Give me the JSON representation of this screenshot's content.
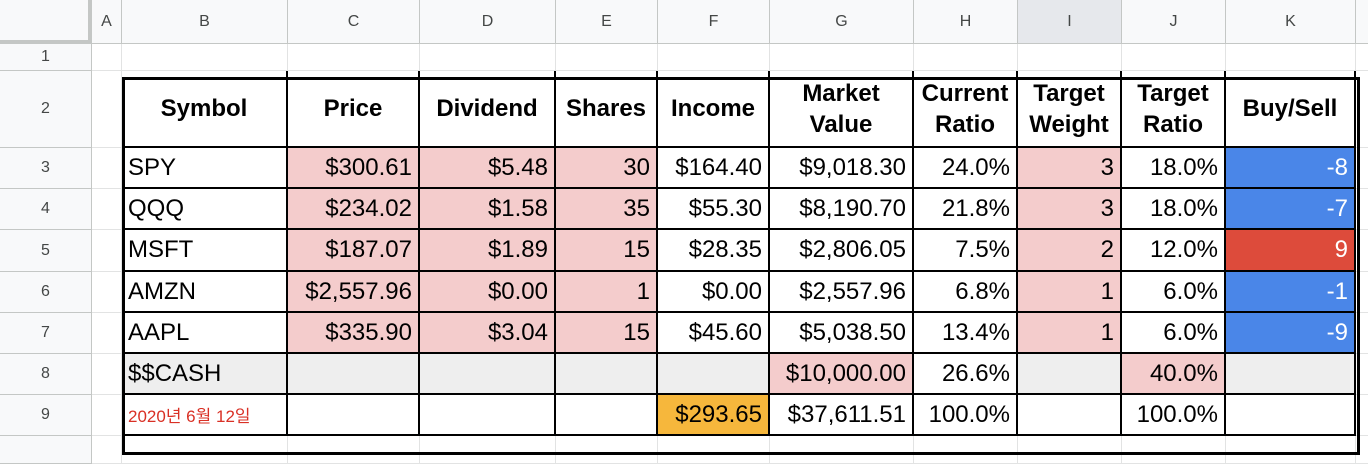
{
  "column_headers": [
    "A",
    "B",
    "C",
    "D",
    "E",
    "F",
    "G",
    "H",
    "I",
    "J",
    "K"
  ],
  "row_headers": [
    "1",
    "2",
    "3",
    "4",
    "5",
    "6",
    "7",
    "8",
    "9"
  ],
  "selected_column": "I",
  "colors": {
    "input_fill": "#f4cccc",
    "cash_row_fill": "#eeeeee",
    "income_total_fill": "#f6b73c",
    "buy_fill": "#dd4b3b",
    "sell_fill": "#4a86e8",
    "date_text": "#d93025"
  },
  "table": {
    "headers": [
      "Symbol",
      "Price",
      "Dividend",
      "Shares",
      "Income",
      "Market Value",
      "Current Ratio",
      "Target Weight",
      "Target Ratio",
      "Buy/Sell"
    ],
    "rows": [
      {
        "symbol": "SPY",
        "price": "$300.61",
        "dividend": "$5.48",
        "shares": "30",
        "income": "$164.40",
        "market_value": "$9,018.30",
        "current_ratio": "24.0%",
        "target_weight": "3",
        "target_ratio": "18.0%",
        "buy_sell": "-8"
      },
      {
        "symbol": "QQQ",
        "price": "$234.02",
        "dividend": "$1.58",
        "shares": "35",
        "income": "$55.30",
        "market_value": "$8,190.70",
        "current_ratio": "21.8%",
        "target_weight": "3",
        "target_ratio": "18.0%",
        "buy_sell": "-7"
      },
      {
        "symbol": "MSFT",
        "price": "$187.07",
        "dividend": "$1.89",
        "shares": "15",
        "income": "$28.35",
        "market_value": "$2,806.05",
        "current_ratio": "7.5%",
        "target_weight": "2",
        "target_ratio": "12.0%",
        "buy_sell": "9"
      },
      {
        "symbol": "AMZN",
        "price": "$2,557.96",
        "dividend": "$0.00",
        "shares": "1",
        "income": "$0.00",
        "market_value": "$2,557.96",
        "current_ratio": "6.8%",
        "target_weight": "1",
        "target_ratio": "6.0%",
        "buy_sell": "-1"
      },
      {
        "symbol": "AAPL",
        "price": "$335.90",
        "dividend": "$3.04",
        "shares": "15",
        "income": "$45.60",
        "market_value": "$5,038.50",
        "current_ratio": "13.4%",
        "target_weight": "1",
        "target_ratio": "6.0%",
        "buy_sell": "-9"
      }
    ],
    "cash": {
      "symbol": "$$CASH",
      "market_value": "$10,000.00",
      "current_ratio": "26.6%",
      "target_ratio": "40.0%"
    },
    "totals": {
      "date": "2020년 6월 12일",
      "income": "$293.65",
      "market_value": "$37,611.51",
      "current_ratio": "100.0%",
      "target_ratio": "100.0%"
    }
  }
}
